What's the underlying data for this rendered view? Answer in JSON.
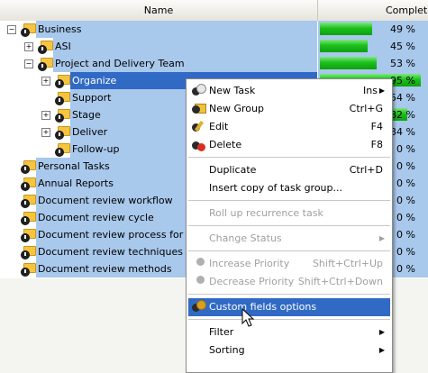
{
  "columns": {
    "name": "Name",
    "complete": "Complete"
  },
  "colors": {
    "selection": "#316ac5",
    "row_highlight": "#a8c8ec",
    "progress": "#1cc01c"
  },
  "tree": [
    {
      "label": "Business",
      "pct_label": "49 %",
      "pct": 49,
      "level": 0,
      "expander": "−"
    },
    {
      "label": "ASI",
      "pct_label": "45 %",
      "pct": 45,
      "level": 1,
      "expander": "+"
    },
    {
      "label": "Project and Delivery Team",
      "pct_label": "53 %",
      "pct": 53,
      "level": 1,
      "expander": "−"
    },
    {
      "label": "Organize",
      "pct_label": "95 %",
      "pct": 95,
      "level": 2,
      "expander": "+",
      "selected": true
    },
    {
      "label": "Support",
      "pct_label": "54 %",
      "pct": 54,
      "level": 2,
      "expander": ""
    },
    {
      "label": "Stage",
      "pct_label": "82 %",
      "pct": 82,
      "level": 2,
      "expander": "+"
    },
    {
      "label": "Deliver",
      "pct_label": "34 %",
      "pct": 34,
      "level": 2,
      "expander": "+"
    },
    {
      "label": "Follow-up",
      "pct_label": "0 %",
      "pct": 0,
      "level": 2,
      "expander": ""
    },
    {
      "label": "Personal Tasks",
      "pct_label": "0 %",
      "pct": 0,
      "level": 0,
      "expander": ""
    },
    {
      "label": "Annual Reports",
      "pct_label": "0 %",
      "pct": 0,
      "level": 0,
      "expander": ""
    },
    {
      "label": "Document review workflow",
      "pct_label": "0 %",
      "pct": 0,
      "level": 0,
      "expander": ""
    },
    {
      "label": "Document review cycle",
      "pct_label": "0 %",
      "pct": 0,
      "level": 0,
      "expander": ""
    },
    {
      "label": "Document review process for c",
      "pct_label": "0 %",
      "pct": 0,
      "level": 0,
      "expander": ""
    },
    {
      "label": "Document review techniques f",
      "pct_label": "0 %",
      "pct": 0,
      "level": 0,
      "expander": ""
    },
    {
      "label": "Document review methods",
      "pct_label": "0 %",
      "pct": 0,
      "level": 0,
      "expander": ""
    }
  ],
  "menu": {
    "items": [
      {
        "label": "New Task",
        "shortcut": "Ins",
        "icon": "new-task-icon",
        "submenu": true
      },
      {
        "label": "New Group",
        "shortcut": "Ctrl+G",
        "icon": "new-group-icon"
      },
      {
        "label": "Edit",
        "shortcut": "F4",
        "icon": "edit-icon"
      },
      {
        "label": "Delete",
        "shortcut": "F8",
        "icon": "delete-icon"
      },
      {
        "label": "Duplicate",
        "shortcut": "Ctrl+D"
      },
      {
        "label": "Insert copy of task group...",
        "shortcut": ""
      },
      {
        "label": "Roll up recurrence task",
        "shortcut": "",
        "disabled": true
      },
      {
        "label": "Change Status",
        "shortcut": "",
        "disabled": true,
        "submenu": true
      },
      {
        "label": "Increase Priority",
        "shortcut": "Shift+Ctrl+Up",
        "disabled": true,
        "icon": "increase-priority-icon"
      },
      {
        "label": "Decrease Priority",
        "shortcut": "Shift+Ctrl+Down",
        "disabled": true,
        "icon": "decrease-priority-icon"
      },
      {
        "label": "Custom fields options",
        "shortcut": "",
        "highlighted": true,
        "icon": "custom-fields-icon"
      },
      {
        "label": "Filter",
        "shortcut": "",
        "submenu": true
      },
      {
        "label": "Sorting",
        "shortcut": "",
        "submenu": true
      }
    ]
  }
}
